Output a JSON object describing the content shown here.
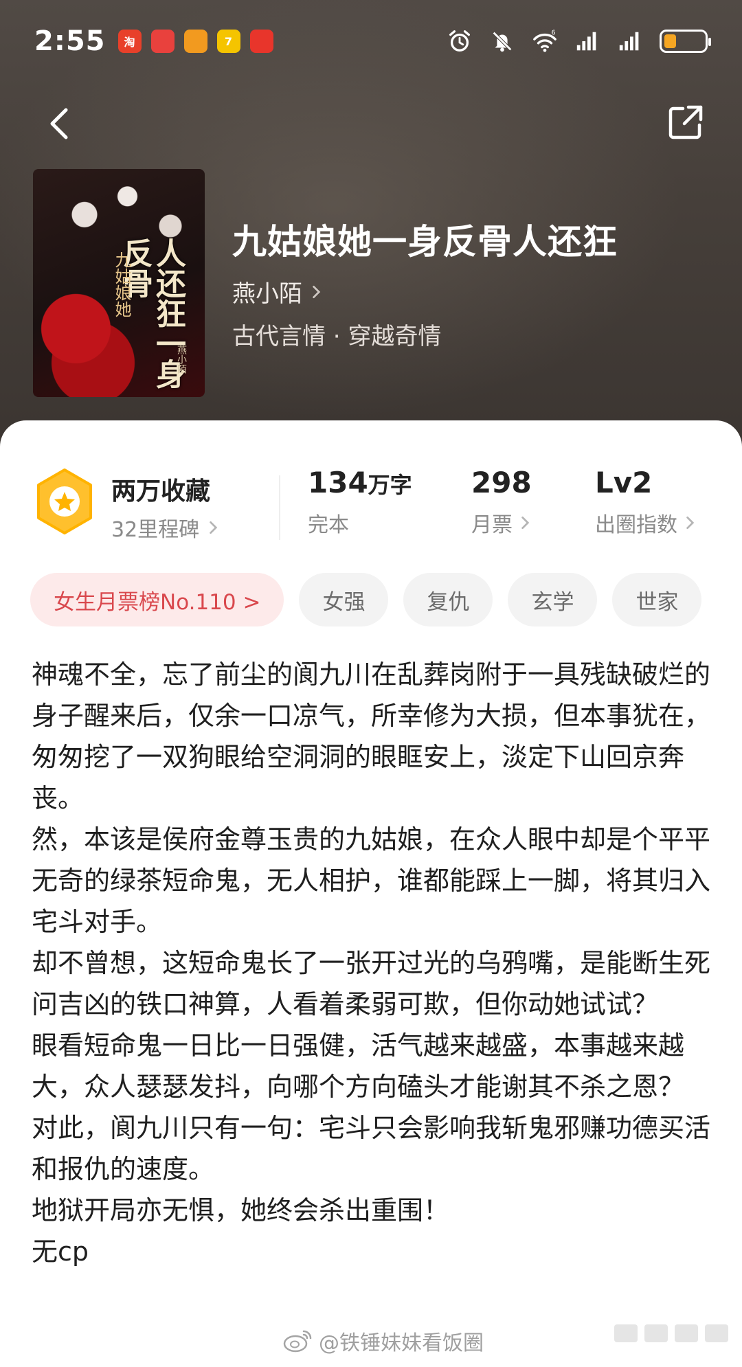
{
  "status_bar": {
    "time": "2:55",
    "apps": [
      {
        "name": "taobao-app-icon",
        "glyph": "淘",
        "color": "#e8402a"
      },
      {
        "name": "red-app-icon",
        "glyph": "",
        "color": "#e9413d"
      },
      {
        "name": "orange-app-icon",
        "glyph": "",
        "color": "#f29a1f"
      },
      {
        "name": "seven-app-icon",
        "glyph": "7",
        "color": "#f5c400"
      },
      {
        "name": "game-app-icon",
        "glyph": "",
        "color": "#e8352b"
      }
    ],
    "signal_label": "6",
    "battery_level": 0.3
  },
  "book": {
    "title": "九姑娘她一身反骨人还狂",
    "author": "燕小陌",
    "genre": "古代言情 · 穿越奇情",
    "cover_title": "人还狂一身反骨",
    "cover_subtitle": "九姑娘她",
    "cover_author": "燕小陌"
  },
  "stats": {
    "favorites": "两万收藏",
    "milestones": "32里程碑",
    "word_count": "134",
    "word_unit": "万字",
    "word_status": "完本",
    "monthly_votes": "298",
    "monthly_votes_label": "月票",
    "level": "Lv2",
    "level_label": "出圈指数"
  },
  "tags": [
    "女生月票榜No.110 >",
    "女强",
    "复仇",
    "玄学",
    "世家"
  ],
  "description": [
    "神魂不全，忘了前尘的阆九川在乱葬岗附于一具残缺破烂的身子醒来后，仅余一口凉气，所幸修为大损，但本事犹在，匆匆挖了一双狗眼给空洞洞的眼眶安上，淡定下山回京奔丧。",
    "然，本该是侯府金尊玉贵的九姑娘，在众人眼中却是个平平无奇的绿茶短命鬼，无人相护，谁都能踩上一脚，将其归入宅斗对手。",
    "却不曾想，这短命鬼长了一张开过光的乌鸦嘴，是能断生死问吉凶的铁口神算，人看着柔弱可欺，但你动她试试？",
    "眼看短命鬼一日比一日强健，活气越来越盛，本事越来越大，众人瑟瑟发抖，向哪个方向磕头才能谢其不杀之恩？",
    "对此，阆九川只有一句：宅斗只会影响我斩鬼邪赚功德买活和报仇的速度。",
    "地狱开局亦无惧，她终会杀出重围！",
    "无cp"
  ],
  "watermark": "@铁锤妹妹看饭圈"
}
